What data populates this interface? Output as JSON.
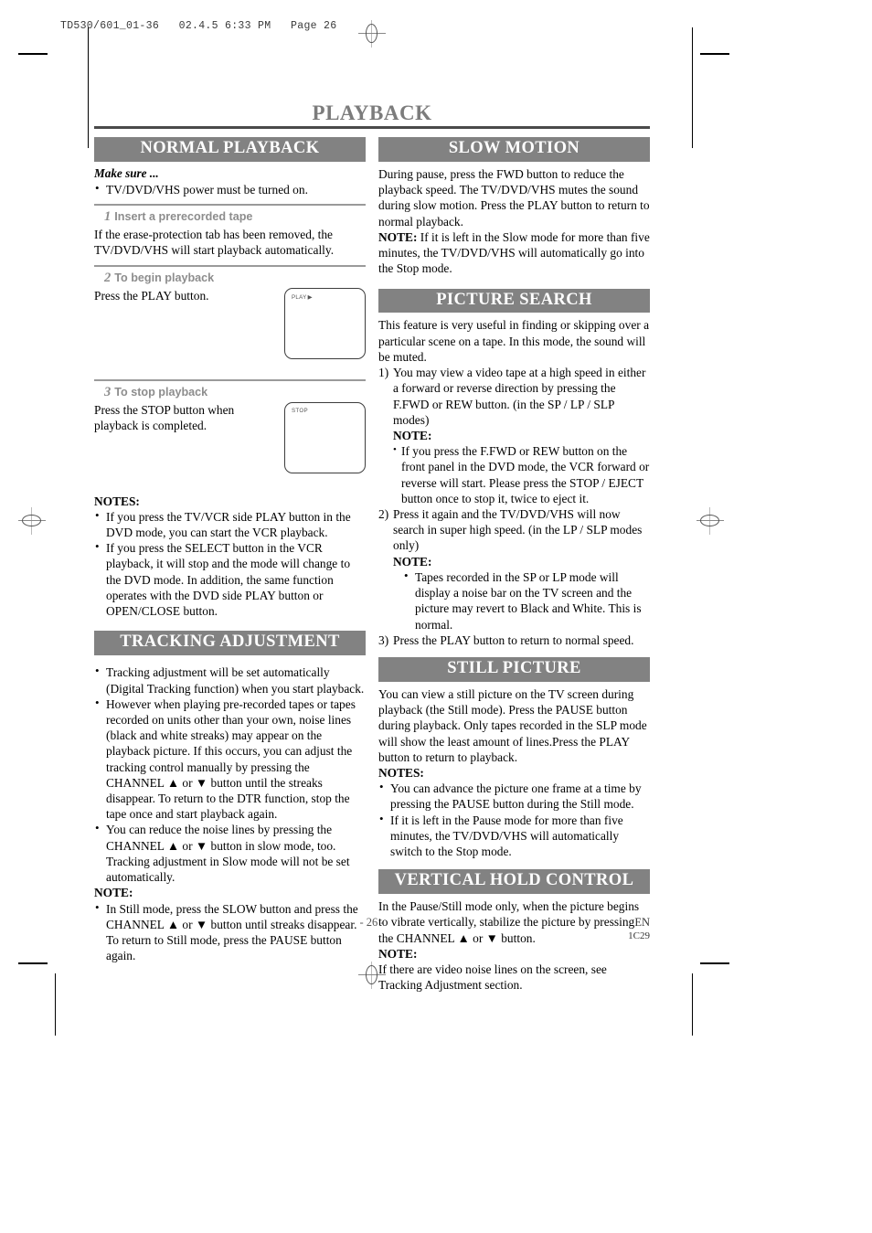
{
  "filestamp": "TD530/601_01-36   02.4.5 6:33 PM   Page 26",
  "page_title": "PLAYBACK",
  "footer": {
    "page_number": "- 26 -",
    "language": "EN",
    "code": "1C29"
  },
  "colors": {
    "header_bar": "#828282",
    "title_text": "#7c7c7c",
    "rule": "#4a4a4a",
    "step_label": "#8d8d8d"
  },
  "left_column": {
    "normal_playback": {
      "header": "NORMAL PLAYBACK",
      "make_sure_label": "Make sure ...",
      "make_sure_items": [
        "TV/DVD/VHS power must be turned on."
      ],
      "steps": [
        {
          "num": "1",
          "title": "Insert a prerecorded tape",
          "text": "If the erase-protection tab has been removed, the TV/DVD/VHS will start playback automatically.",
          "screen": null
        },
        {
          "num": "2",
          "title": "To begin playback",
          "text": "Press the PLAY button.",
          "screen": {
            "label": "PLAY",
            "icon": "play-triangle"
          }
        },
        {
          "num": "3",
          "title": "To stop playback",
          "text": "Press the STOP button when playback is completed.",
          "screen": {
            "label": "STOP",
            "icon": null
          }
        }
      ],
      "notes_label": "NOTES:",
      "notes": [
        "If you press the TV/VCR side PLAY button in the DVD mode, you can start the VCR playback.",
        "If you press the SELECT button in the VCR playback, it will stop and the mode will change to the DVD mode. In addition, the same function operates with the DVD side PLAY button or OPEN/CLOSE button."
      ]
    },
    "tracking_adjustment": {
      "header": "TRACKING ADJUSTMENT",
      "bullets": [
        "Tracking adjustment will be set automatically (Digital Tracking function) when you start playback.",
        "However when playing pre-recorded tapes or tapes recorded on units other than your own, noise lines (black and white streaks) may appear on the playback picture. If this occurs, you can adjust the tracking control manually by pressing the CHANNEL ▲ or ▼ button until the streaks disappear. To return to the DTR function, stop the tape once and start playback again.",
        "You can reduce the noise lines by pressing the CHANNEL ▲ or ▼ button in slow mode, too. Tracking adjustment in Slow mode will not be set automatically."
      ],
      "note_label": "NOTE:",
      "note_bullets": [
        "In Still mode, press the SLOW button and press the CHANNEL ▲ or ▼ button until streaks disappear. To return to Still mode, press the PAUSE button again."
      ]
    }
  },
  "right_column": {
    "slow_motion": {
      "header": "SLOW MOTION",
      "body": "During pause, press the FWD button to reduce the playback speed. The TV/DVD/VHS mutes the sound during slow motion. Press the PLAY button to return to normal playback.",
      "note_label": "NOTE:",
      "note_text": " If it is left in the Slow mode for more than five minutes, the TV/DVD/VHS will automatically go into the Stop mode."
    },
    "picture_search": {
      "header": "PICTURE SEARCH",
      "intro": "This feature is very useful in finding or skipping over a particular scene on a tape. In this mode, the sound will be muted.",
      "items": [
        {
          "num": "1)",
          "text": "You may view a video tape at a high speed in either a forward or reverse direction by pressing the F.FWD or REW button. (in the SP / LP / SLP modes)",
          "note_label": "NOTE:",
          "note_bullets": [
            "If you press the F.FWD or REW button on the front panel in the DVD mode, the VCR forward or reverse will start. Please press the STOP / EJECT button once to stop it, twice to eject it."
          ]
        },
        {
          "num": "2)",
          "text": "Press it again and the TV/DVD/VHS will now search in super high speed. (in the LP / SLP modes only)",
          "note_label": "NOTE:",
          "note_bullets": [
            "Tapes recorded in the SP or LP mode will display a noise bar on the TV screen and the picture may revert to Black and White. This is normal."
          ]
        },
        {
          "num": "3)",
          "text": "Press the PLAY button to return to normal speed.",
          "note_label": null,
          "note_bullets": []
        }
      ]
    },
    "still_picture": {
      "header": "STILL PICTURE",
      "body": "You can view a still picture on the TV screen during playback (the Still mode). Press the PAUSE button during playback. Only tapes recorded in the SLP mode will show the least amount of lines.Press the PLAY button to return to playback.",
      "notes_label": "NOTES:",
      "notes": [
        "You can advance the picture one frame at a time by pressing the PAUSE button during the Still mode.",
        "If it is left in the Pause mode for more than five minutes, the TV/DVD/VHS will automatically switch to the Stop mode."
      ]
    },
    "vertical_hold_control": {
      "header": "VERTICAL HOLD CONTROL",
      "body": "In the Pause/Still mode only, when the picture begins to vibrate vertically, stabilize the picture by pressing the CHANNEL ▲ or ▼ button.",
      "note_label": "NOTE:",
      "note_text": "If there are video noise lines on the screen, see Tracking Adjustment section."
    }
  }
}
